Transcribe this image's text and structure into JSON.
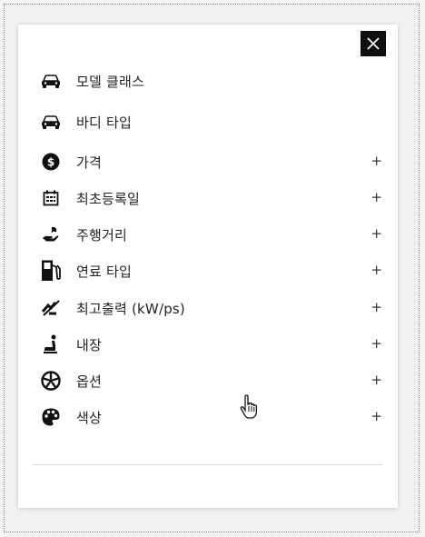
{
  "filter_panel": {
    "close_icon": "close-icon",
    "items": [
      {
        "label": "모델 클래스",
        "icon": "car-icon",
        "expandable": false,
        "plus": ""
      },
      {
        "label": "바디 타입",
        "icon": "car-body-icon",
        "expandable": false,
        "plus": ""
      },
      {
        "label": "가격",
        "icon": "dollar-circle-icon",
        "expandable": true,
        "plus": "+"
      },
      {
        "label": "최초등록일",
        "icon": "calendar-icon",
        "expandable": true,
        "plus": "+"
      },
      {
        "label": "주행거리",
        "icon": "hand-leaf-icon",
        "expandable": true,
        "plus": "+"
      },
      {
        "label": "연료 타입",
        "icon": "fuel-pump-icon",
        "expandable": true,
        "plus": "+"
      },
      {
        "label": "최고출력 (kW/ps)",
        "icon": "speed-off-icon",
        "expandable": true,
        "plus": "+"
      },
      {
        "label": "내장",
        "icon": "car-seat-icon",
        "expandable": true,
        "plus": "+"
      },
      {
        "label": "옵션",
        "icon": "wheel-icon",
        "expandable": true,
        "plus": "+"
      },
      {
        "label": "색상",
        "icon": "palette-icon",
        "expandable": true,
        "plus": "+"
      }
    ]
  },
  "colors": {
    "text": "#222222",
    "icon": "#111111",
    "close_bg": "#0f0f0f"
  }
}
